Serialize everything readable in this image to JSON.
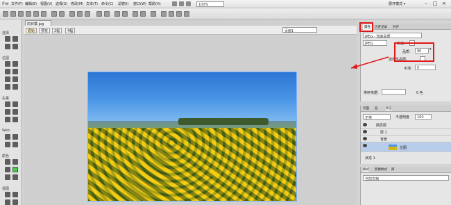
{
  "menubar": {
    "logo": "Fw",
    "items": [
      "文件(F)",
      "编辑(E)",
      "视图(V)",
      "选择(S)",
      "修改(M)",
      "文本(T)",
      "命令(C)",
      "滤镜(I)",
      "窗口(W)",
      "帮助(H)"
    ],
    "zoom": "100%",
    "mode": "展开模式 ▾"
  },
  "doc": {
    "tab_name": "向日葵.jpg"
  },
  "viewbar": {
    "original": "原始",
    "preview": "预览",
    "twoup": "2幅",
    "fourup": "4幅",
    "page": "页面1"
  },
  "tools": {
    "sections": [
      "选择",
      "位图",
      "矢量",
      "Web",
      "颜色",
      "视图"
    ]
  },
  "props": {
    "tabs": [
      "属性",
      "历史记录",
      "对齐"
    ],
    "format": "JPEG",
    "quality_label": "品质:",
    "quality_value": "90",
    "selective_label": "选择性品质:",
    "smoothing_label": "平滑:",
    "smoothing_value": "0",
    "preset_label": "JPEG - 较高品质",
    "matte_label": "杂边:",
    "sort_label": "排序依据:",
    "colors_label": "0 色"
  },
  "layers": {
    "tabs": [
      "页面",
      "层",
      "状态"
    ],
    "blend": "正常",
    "opacity_label": "不透明度",
    "opacity_value": "100",
    "rows": [
      "网页层",
      "层 1",
      "背景",
      "位图"
    ],
    "status": "状态 1"
  },
  "styles": {
    "tabs": [
      "样式",
      "新建样式",
      "库"
    ],
    "current": "当前文档"
  }
}
